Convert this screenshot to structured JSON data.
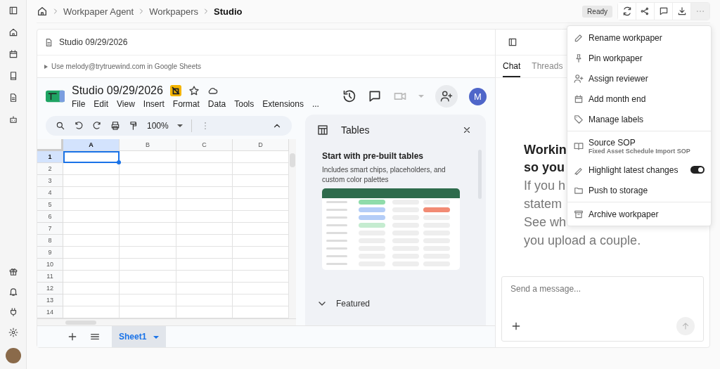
{
  "breadcrumbs": [
    {
      "label": "Workpaper Agent",
      "current": false
    },
    {
      "label": "Workpapers",
      "current": false
    },
    {
      "label": "Studio",
      "current": true
    }
  ],
  "status_badge": "Ready",
  "document": {
    "title": "Studio 09/29/2026",
    "hint": "Use melody@trytruewind.com in Google Sheets"
  },
  "sheets": {
    "title": "Studio 09/29/2026",
    "menus": [
      "File",
      "Edit",
      "View",
      "Insert",
      "Format",
      "Data",
      "Tools",
      "Extensions"
    ],
    "menu_more": "...",
    "zoom": "100%",
    "avatar": "M",
    "columns": [
      {
        "label": "A",
        "selected": true
      },
      {
        "label": "B",
        "selected": false
      },
      {
        "label": "C",
        "selected": false
      },
      {
        "label": "D",
        "selected": false
      }
    ],
    "rows": [
      {
        "label": "1",
        "selected": true
      },
      {
        "label": "2",
        "selected": false
      },
      {
        "label": "3",
        "selected": false
      },
      {
        "label": "4",
        "selected": false
      },
      {
        "label": "5",
        "selected": false
      },
      {
        "label": "6",
        "selected": false
      },
      {
        "label": "7",
        "selected": false
      },
      {
        "label": "8",
        "selected": false
      },
      {
        "label": "9",
        "selected": false
      },
      {
        "label": "10",
        "selected": false
      },
      {
        "label": "11",
        "selected": false
      },
      {
        "label": "12",
        "selected": false
      },
      {
        "label": "13",
        "selected": false
      },
      {
        "label": "14",
        "selected": false
      }
    ],
    "sheet_tabs": [
      {
        "label": "Sheet1",
        "selected": true
      }
    ],
    "tables_panel": {
      "title": "Tables",
      "heading": "Start with pre-built tables",
      "description": "Includes smart chips, placeholders, and custom color palettes",
      "section": "Featured"
    }
  },
  "chat": {
    "tabs": [
      {
        "label": "Chat",
        "selected": true
      },
      {
        "label": "Threads",
        "selected": false
      }
    ],
    "heading_lines": [
      "Workin",
      "so you"
    ],
    "body_lines": [
      "If you h",
      "statem",
      "See wh",
      "you upload a couple."
    ],
    "composer": {
      "placeholder": "Send a message..."
    }
  },
  "menu": {
    "groups": [
      [
        {
          "kind": "item",
          "label": "Rename workpaper"
        },
        {
          "kind": "item",
          "label": "Pin workpaper"
        },
        {
          "kind": "item",
          "label": "Assign reviewer"
        },
        {
          "kind": "item",
          "label": "Add month end"
        },
        {
          "kind": "item",
          "label": "Manage labels"
        }
      ],
      [
        {
          "kind": "detail",
          "label": "Source SOP",
          "detail": "Fixed Asset Schedule Import SOP"
        },
        {
          "kind": "toggle",
          "label": "Highlight latest changes",
          "on": true
        },
        {
          "kind": "item",
          "label": "Push to storage"
        }
      ],
      [
        {
          "kind": "item",
          "label": "Archive workpaper"
        }
      ]
    ]
  }
}
